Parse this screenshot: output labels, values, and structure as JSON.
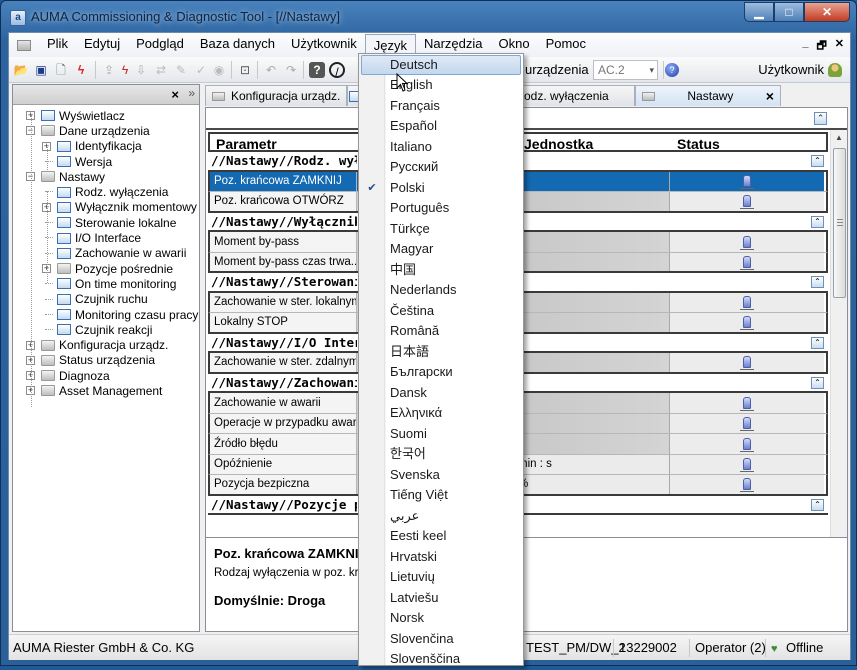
{
  "window": {
    "title": "AUMA Commissioning & Diagnostic Tool - [//Nastawy]",
    "app_icon": "auma-app-icon",
    "controls": [
      "minimize",
      "maximize",
      "close"
    ]
  },
  "menubar": {
    "items": [
      {
        "label": "Plik"
      },
      {
        "label": "Edytuj"
      },
      {
        "label": "Podgląd"
      },
      {
        "label": "Baza danych"
      },
      {
        "label": "Użytkownik"
      },
      {
        "label": "Język",
        "open": true
      },
      {
        "label": "Narzędzia"
      },
      {
        "label": "Okno"
      },
      {
        "label": "Pomoc"
      }
    ],
    "mdi_controls": [
      "_",
      "🗗",
      "✕"
    ]
  },
  "toolbar": {
    "device_label": "urządzenia",
    "device_combo_value": "AC.2",
    "user_label": "Użytkownik",
    "icons": [
      "open-folder-icon",
      "save-icon",
      "print-preview-icon",
      "connect-icon",
      "disconnect-icon",
      "upload-icon",
      "download-icon",
      "compare-icon",
      "check-icon",
      "record-icon",
      "screenshot-icon",
      "undo-icon",
      "redo-icon",
      "help-icon",
      "stop-icon",
      "info-icon"
    ]
  },
  "sidebar": {
    "close_label": "×",
    "expand_label": "»",
    "tree": [
      {
        "label": "Wyświetlacz",
        "level": 0,
        "icon": "page",
        "expander": "+"
      },
      {
        "label": "Dane urządzenia",
        "level": 0,
        "icon": "folder",
        "expander": "-"
      },
      {
        "label": "Identyfikacja",
        "level": 1,
        "icon": "page",
        "expander": "+"
      },
      {
        "label": "Wersja",
        "level": 1,
        "icon": "page",
        "expander": ""
      },
      {
        "label": "Nastawy",
        "level": 0,
        "icon": "folder-open",
        "expander": "-"
      },
      {
        "label": "Rodz. wyłączenia",
        "level": 1,
        "icon": "page",
        "expander": ""
      },
      {
        "label": "Wyłącznik momentowy",
        "level": 1,
        "icon": "page",
        "expander": "+"
      },
      {
        "label": "Sterowanie lokalne",
        "level": 1,
        "icon": "page",
        "expander": ""
      },
      {
        "label": "I/O Interface",
        "level": 1,
        "icon": "page",
        "expander": ""
      },
      {
        "label": "Zachowanie w awarii",
        "level": 1,
        "icon": "page",
        "expander": ""
      },
      {
        "label": "Pozycje pośrednie",
        "level": 1,
        "icon": "folder",
        "expander": "+"
      },
      {
        "label": "On time monitoring",
        "level": 1,
        "icon": "page",
        "expander": ""
      },
      {
        "label": "Czujnik ruchu",
        "level": 1,
        "icon": "page",
        "expander": ""
      },
      {
        "label": "Monitoring czasu pracy",
        "level": 1,
        "icon": "page",
        "expander": ""
      },
      {
        "label": "Czujnik reakcji",
        "level": 1,
        "icon": "page",
        "expander": ""
      },
      {
        "label": "Konfiguracja urządz.",
        "level": 0,
        "icon": "folder",
        "expander": "+"
      },
      {
        "label": "Status urządzenia",
        "level": 0,
        "icon": "folder",
        "expander": "+"
      },
      {
        "label": "Diagnoza",
        "level": 0,
        "icon": "folder",
        "expander": "+"
      },
      {
        "label": "Asset Management",
        "level": 0,
        "icon": "folder",
        "expander": "+"
      }
    ]
  },
  "tabs": [
    {
      "label": "Konfiguracja urządz.",
      "icon": "folder"
    },
    {
      "label": "",
      "icon": "page"
    },
    {
      "label": "odz. wyłączenia",
      "icon": "page"
    },
    {
      "label": "Nastawy",
      "icon": "folder",
      "active": true,
      "close": "×"
    }
  ],
  "grid": {
    "columns": [
      "Parametr",
      "",
      "Jednostka",
      "Status"
    ],
    "sections": [
      {
        "title": "//Nastawy//Rodz. wyłączenia",
        "rows": [
          {
            "param": "Poz. krańcowa ZAMKNIJ",
            "unit": "",
            "selected": true
          },
          {
            "param": "Poz. krańcowa OTWÓRZ",
            "unit": ""
          }
        ]
      },
      {
        "title": "//Nastawy//Wyłącznik momentowy",
        "rows": [
          {
            "param": "Moment by-pass",
            "unit": ""
          },
          {
            "param": "Moment by-pass czas trwa...",
            "unit": ""
          }
        ]
      },
      {
        "title": "//Nastawy//Sterowanie lokalne",
        "rows": [
          {
            "param": "Zachowanie w ster. lokalnym",
            "unit": ""
          },
          {
            "param": "Lokalny STOP",
            "unit": ""
          }
        ]
      },
      {
        "title": "//Nastawy//I/O Interface",
        "rows": [
          {
            "param": "Zachowanie w ster. zdalnym",
            "unit": ""
          }
        ]
      },
      {
        "title": "//Nastawy//Zachowanie w awarii",
        "rows": [
          {
            "param": "Zachowanie w awarii",
            "unit": ""
          },
          {
            "param": "Operacje w przypadku awarii",
            "unit": ""
          },
          {
            "param": "Źródło błędu",
            "unit": ""
          },
          {
            "param": "Opóźnienie",
            "unit": "min : s",
            "light": true
          },
          {
            "param": "Pozycja bezpiczna",
            "unit": "%",
            "light": true
          }
        ]
      },
      {
        "title": "//Nastawy//Pozycje pośrednie",
        "rows": []
      }
    ]
  },
  "description": {
    "title": "Poz. krańcowa ZAMKNIJ",
    "text": "Rodzaj wyłączenia w poz. krańcowej ZAMKNIJ",
    "default": "Domyślnie: Droga"
  },
  "statusbar": {
    "company": "AUMA Riester GmbH & Co. KG",
    "device": "TEST_PM/DW_2",
    "serial": "13229002",
    "user": "Operator (2)",
    "connection": "Offline"
  },
  "language_menu": {
    "hovered": "Deutsch",
    "checked": "Polski",
    "items": [
      "Deutsch",
      "English",
      "Français",
      "Español",
      "Italiano",
      "Русский",
      "Polski",
      "Português",
      "Türkçe",
      "Magyar",
      "中国",
      "Nederlands",
      "Čeština",
      "Română",
      "日本語",
      "Български",
      "Dansk",
      "Ελληνικά",
      "Suomi",
      "한국어",
      "Svenska",
      "Tiếng Việt",
      "عربي",
      "Eesti keel",
      "Hrvatski",
      "Lietuvių",
      "Latviešu",
      "Norsk",
      "Slovenčina",
      "Slovenščina"
    ]
  }
}
